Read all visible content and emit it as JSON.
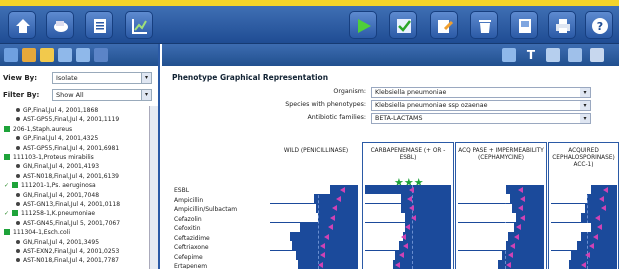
{
  "toolbar": {
    "left_icons": [
      "home-icon",
      "hand-icon",
      "report-icon",
      "chart-icon"
    ],
    "right_icons": [
      "play-icon",
      "check-icon",
      "edit-icon",
      "recycle-icon",
      "print-preview-icon",
      "print-icon",
      "help-icon"
    ]
  },
  "filters": {
    "view_by_label": "View By:",
    "view_by_value": "Isolate",
    "filter_by_label": "Filter By:",
    "filter_by_value": "Show All"
  },
  "tree": [
    {
      "kind": "detail",
      "text": "GP,Final,Jul 4, 2001,1868"
    },
    {
      "kind": "detail",
      "text": "AST-GP55,Final,Jul 4, 2001,1119"
    },
    {
      "kind": "isolate",
      "text": "206-1,Staph.aureus"
    },
    {
      "kind": "detail",
      "text": "GP,Final,Jul 4, 2001,4325"
    },
    {
      "kind": "detail",
      "text": "AST-GP55,Final,Jul 4, 2001,6981"
    },
    {
      "kind": "isolate",
      "text": "111103-1,Proteus mirabilis"
    },
    {
      "kind": "detail",
      "text": "GN,Final,Jul 4, 2001,4193"
    },
    {
      "kind": "detail",
      "text": "AST-N018,Final,Jul 4, 2001,6139"
    },
    {
      "kind": "isolate_check",
      "text": "111201-1,Ps. aeruginosa"
    },
    {
      "kind": "detail",
      "text": "GN,Final,Jul 4, 2001,7048"
    },
    {
      "kind": "detail",
      "text": "AST-GN13,Final,Jul 4, 2001,0118"
    },
    {
      "kind": "isolate_check",
      "text": "111258-1,K.pneumoniae"
    },
    {
      "kind": "detail",
      "text": "AST-GN45,Final,Jul 5, 2001,7067"
    },
    {
      "kind": "isolate",
      "text": "111304-1,Esch.coli"
    },
    {
      "kind": "detail",
      "text": "GN,Final,Jul 4, 2001,3495"
    },
    {
      "kind": "detail",
      "text": "AST-EXN2,Final,Jul 4, 2001,0253"
    },
    {
      "kind": "detail",
      "text": "AST-N018,Final,Jul 4, 2001,7787"
    }
  ],
  "panel": {
    "title": "Phenotype Graphical Representation",
    "organism_label": "Organism:",
    "organism_value": "Klebsiella pneumoniae",
    "species_label": "Species with phenotypes:",
    "species_value": "Klebsiella pneumoniae ssp ozaenae",
    "families_label": "Antibiotic families:",
    "families_value": "BETA-LACTAMS"
  },
  "columns": [
    {
      "label": "WILD (PENICILLINASE)"
    },
    {
      "label": "CARBAPENEMASE (+ OR - ESBL)",
      "stars": "★★★"
    },
    {
      "label": "ACQ PASE + IMPERMEABILITY (CEPHAMYCINE)"
    },
    {
      "label": "ACQUIRED CEPHALOSPORINASE) ACC-1)"
    }
  ],
  "antibiotics": [
    "ESBL",
    "Ampicillin",
    "Ampicillin/Sulbactam",
    "Cefazolin",
    "Cefoxitin",
    "Ceftazidime",
    "Ceftriaxone",
    "Cefepime",
    "Ertapenem"
  ],
  "colors": {
    "accent": "#2b5aa6",
    "bar": "#1b4a9b",
    "marker": "#d042b4",
    "stars": "#1ea33a",
    "top_strip": "#f4d42a"
  }
}
